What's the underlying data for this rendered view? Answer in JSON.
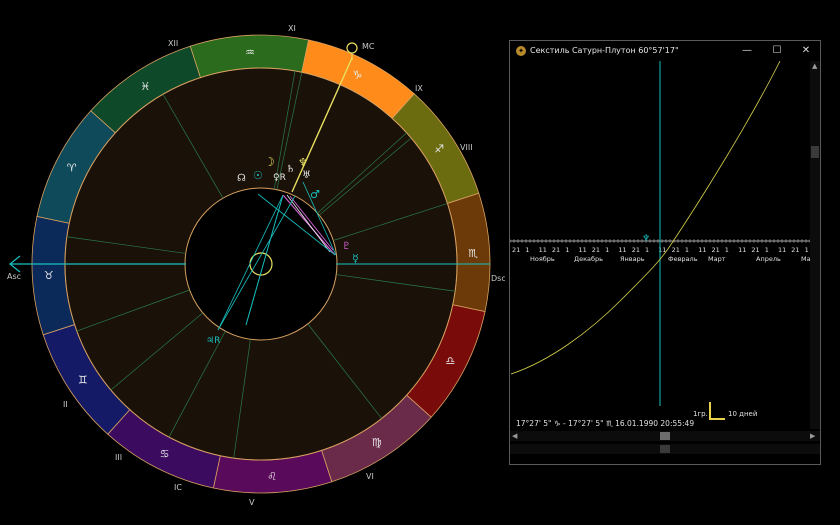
{
  "chart": {
    "house_labels": [
      "XII",
      "XI",
      "IX",
      "VIII",
      "Dsc",
      "VI",
      "V",
      "IC",
      "III",
      "II",
      "Asc"
    ],
    "mc_label": "MC",
    "zodiac_glyphs": [
      "♒",
      "♑",
      "♐",
      "♏",
      "♎",
      "♍",
      "♌",
      "♋",
      "♊",
      "♉",
      "♈",
      "♓"
    ],
    "zodiac_colors": [
      "#2b6b1e",
      "#ff8c1a",
      "#6b6b10",
      "#6b3a08",
      "#7a0b0b",
      "#6a2b4a",
      "#5a0a5a",
      "#3a0b5e",
      "#151a66",
      "#0b2a5a",
      "#0e4a5a",
      "#0e4a2a"
    ],
    "planets": {
      "sun": "☉",
      "moon": "☽",
      "node": "☊",
      "pluto_r": "♀R",
      "saturn": "♄",
      "neptune": "♆",
      "uranus": "♅",
      "mars": "♂",
      "pluto2": "♇",
      "mercury": "☿",
      "jupiter_r": "♃R"
    }
  },
  "window": {
    "title": "Секстиль Сатурн-Плутон  60°57'17\"",
    "buttons": {
      "minimize": "—",
      "maximize": "☐",
      "close": "✕"
    },
    "axis_numbers": [
      "21",
      "1",
      "11",
      "21",
      "1",
      "11",
      "21",
      "1",
      "11",
      "21",
      "1",
      "11",
      "21",
      "1",
      "11",
      "21",
      "1",
      "11",
      "21",
      "1",
      "11",
      "21",
      "1"
    ],
    "month_labels": [
      "Ноябрь",
      "Декабрь",
      "Январь",
      "Февраль",
      "Март",
      "Апрель",
      "Ма"
    ],
    "scale_deg": "1гр.",
    "scale_days": "10 дней",
    "status": "17°27' 5\" ♑ - 17°27' 5\" ♏  16.01.1990 20:55:49",
    "colors": {
      "curve": "#d7d24a",
      "cursor": "#18c0c0",
      "axis": "#e0e0e0"
    }
  }
}
